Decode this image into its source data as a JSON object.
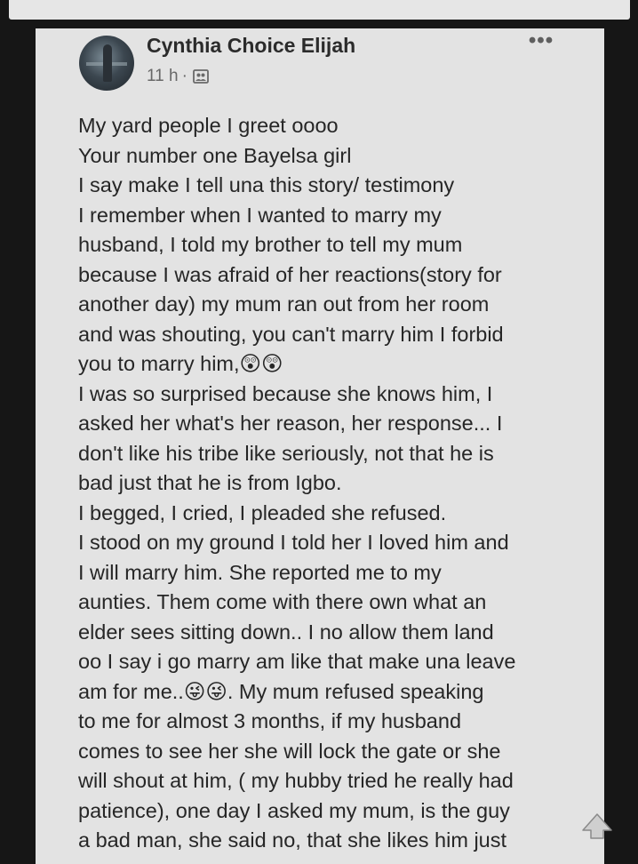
{
  "post": {
    "author": "Cynthia Choice Elijah",
    "time": "11 h",
    "separator": "·",
    "more_label": "•••",
    "audience_icon": "friends-icon",
    "lines": [
      "My yard people I greet oooo",
      "Your number one Bayelsa girl",
      "I say make I tell una this story/ testimony",
      "I remember when I wanted to marry my",
      "husband, I told my brother to tell my mum",
      "because I was afraid of her reactions(story for",
      "another day) my mum ran out from her room",
      "and was shouting, you can't marry him I forbid",
      "you to marry him,😲😲",
      "I was so surprised because she knows him, I",
      "asked her what's her reason, her response... I",
      "don't like his tribe like seriously, not that he is",
      "bad just that he is from Igbo.",
      "I begged, I cried, I pleaded she refused.",
      "I stood on my ground I told her I loved him and",
      "I will marry him. She reported me to my",
      "aunties. Them come with there own what an",
      "elder sees sitting down.. I no allow them land",
      "oo I say i go marry am like that make una leave",
      "am for me..😜😜. My mum refused speaking",
      "to me for almost 3 months, if my husband",
      "comes to see her she will lock the gate or she",
      "will shout at him, ( my hubby tried he really had",
      "patience), one day I asked my mum, is the guy",
      "a bad man, she said no, that she likes him just"
    ]
  },
  "icons": {
    "scroll_top": "scroll-to-top-icon",
    "more": "more-options-icon"
  },
  "colors": {
    "background": "#161616",
    "card": "#e3e3e3",
    "text": "#262626",
    "meta": "#686868"
  }
}
